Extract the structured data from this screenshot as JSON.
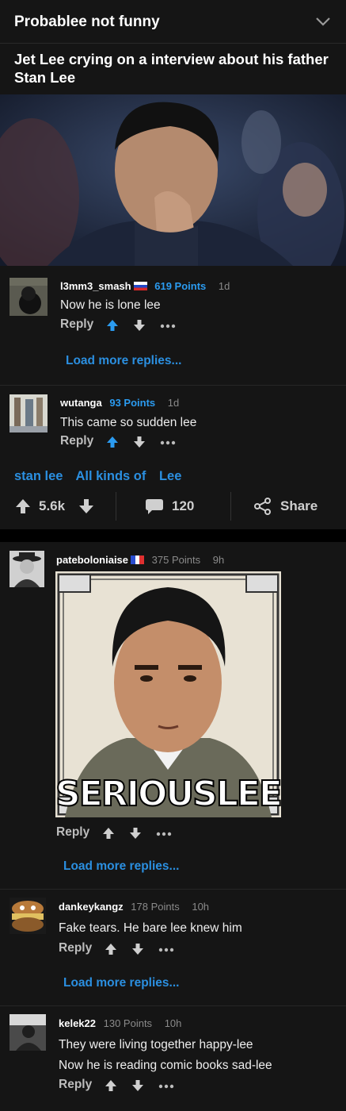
{
  "post": {
    "section": "Probablee not funny",
    "title": "Jet Lee crying on a interview about his father Stan Lee",
    "tags": [
      "stan lee",
      "All kinds of",
      "Lee"
    ],
    "upvotes": "5.6k",
    "comments_count": "120",
    "share_label": "Share"
  },
  "thread1": [
    {
      "user": "l3mm3_smash",
      "points": "619 Points",
      "age": "1d",
      "text": "Now he is lone lee",
      "reply": "Reply"
    },
    {
      "user": "wutanga",
      "points": "93 Points",
      "age": "1d",
      "text": "This came so sudden lee",
      "reply": "Reply"
    }
  ],
  "load_more_label": "Load more replies...",
  "thread2": [
    {
      "user": "pateboloniaise",
      "points": "375 Points",
      "age": "9h",
      "reply": "Reply",
      "meme_caption": "SERIOUSLEE"
    },
    {
      "user": "dankeykangz",
      "points": "178 Points",
      "age": "10h",
      "text": "Fake tears. He bare lee knew him",
      "reply": "Reply"
    },
    {
      "user": "kelek22",
      "points": "130 Points",
      "age": "10h",
      "text_line1": "They were living together happy-lee",
      "text_line2": "Now he is reading comic books sad-lee",
      "reply": "Reply"
    }
  ],
  "colors": {
    "accent_blue": "#2b8fe0",
    "background": "#151515",
    "page": "#000000"
  },
  "icons": [
    "chevron-down-icon",
    "upvote-arrow-icon",
    "downvote-arrow-icon",
    "more-dots-icon",
    "comment-bubble-icon",
    "share-icon",
    "russia-flag-icon",
    "france-flag-icon"
  ]
}
